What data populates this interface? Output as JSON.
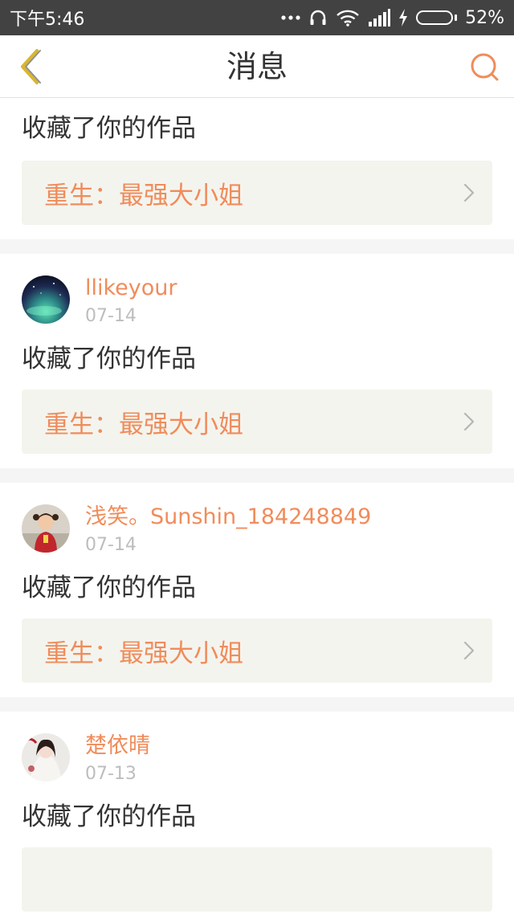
{
  "status_bar": {
    "time": "下午5:46",
    "battery_percent": "52%",
    "battery_level": 0.52,
    "icons": [
      "more-dots-icon",
      "headphones-icon",
      "wifi-icon",
      "signal-icon",
      "charging-icon",
      "battery-icon"
    ]
  },
  "header": {
    "title": "消息",
    "back_icon": "chevron-left-icon",
    "search_icon": "search-icon"
  },
  "colors": {
    "accent": "#f08c5b",
    "back_icon": "#d9b62e",
    "status_bar_bg": "#424242",
    "work_box_bg": "#f4f4ee"
  },
  "messages": [
    {
      "action": "收藏了你的作品",
      "work_title": "重生：最强大小姐"
    },
    {
      "username": "llikeyour",
      "date": "07-14",
      "action": "收藏了你的作品",
      "work_title": "重生：最强大小姐"
    },
    {
      "username": "浅笑。Sunshin_184248849",
      "date": "07-14",
      "action": "收藏了你的作品",
      "work_title": "重生：最强大小姐"
    },
    {
      "username": "楚依晴",
      "date": "07-13",
      "action": "收藏了你的作品"
    }
  ]
}
